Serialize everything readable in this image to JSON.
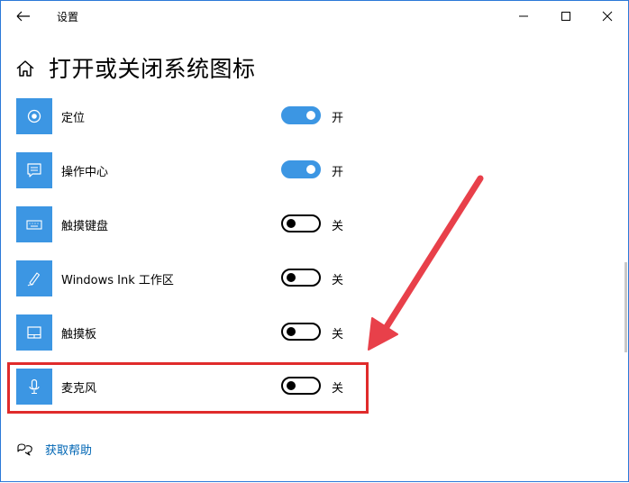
{
  "window": {
    "title": "设置",
    "controls": [
      "minimize",
      "maximize",
      "close"
    ]
  },
  "header": {
    "page_title": "打开或关闭系统图标"
  },
  "items": [
    {
      "label": "定位",
      "state": "开",
      "on": true,
      "icon": "location-icon"
    },
    {
      "label": "操作中心",
      "state": "开",
      "on": true,
      "icon": "action-center-icon"
    },
    {
      "label": "触摸键盘",
      "state": "关",
      "on": false,
      "icon": "keyboard-icon"
    },
    {
      "label": "Windows Ink 工作区",
      "state": "关",
      "on": false,
      "icon": "pen-icon"
    },
    {
      "label": "触摸板",
      "state": "关",
      "on": false,
      "icon": "touchpad-icon"
    },
    {
      "label": "麦克风",
      "state": "关",
      "on": false,
      "icon": "microphone-icon",
      "highlighted": true
    }
  ],
  "help": {
    "label": "获取帮助",
    "icon": "chat-help-icon"
  },
  "colors": {
    "accent": "#3c96e3",
    "highlight": "#e02b2b",
    "link": "#0066b4"
  }
}
